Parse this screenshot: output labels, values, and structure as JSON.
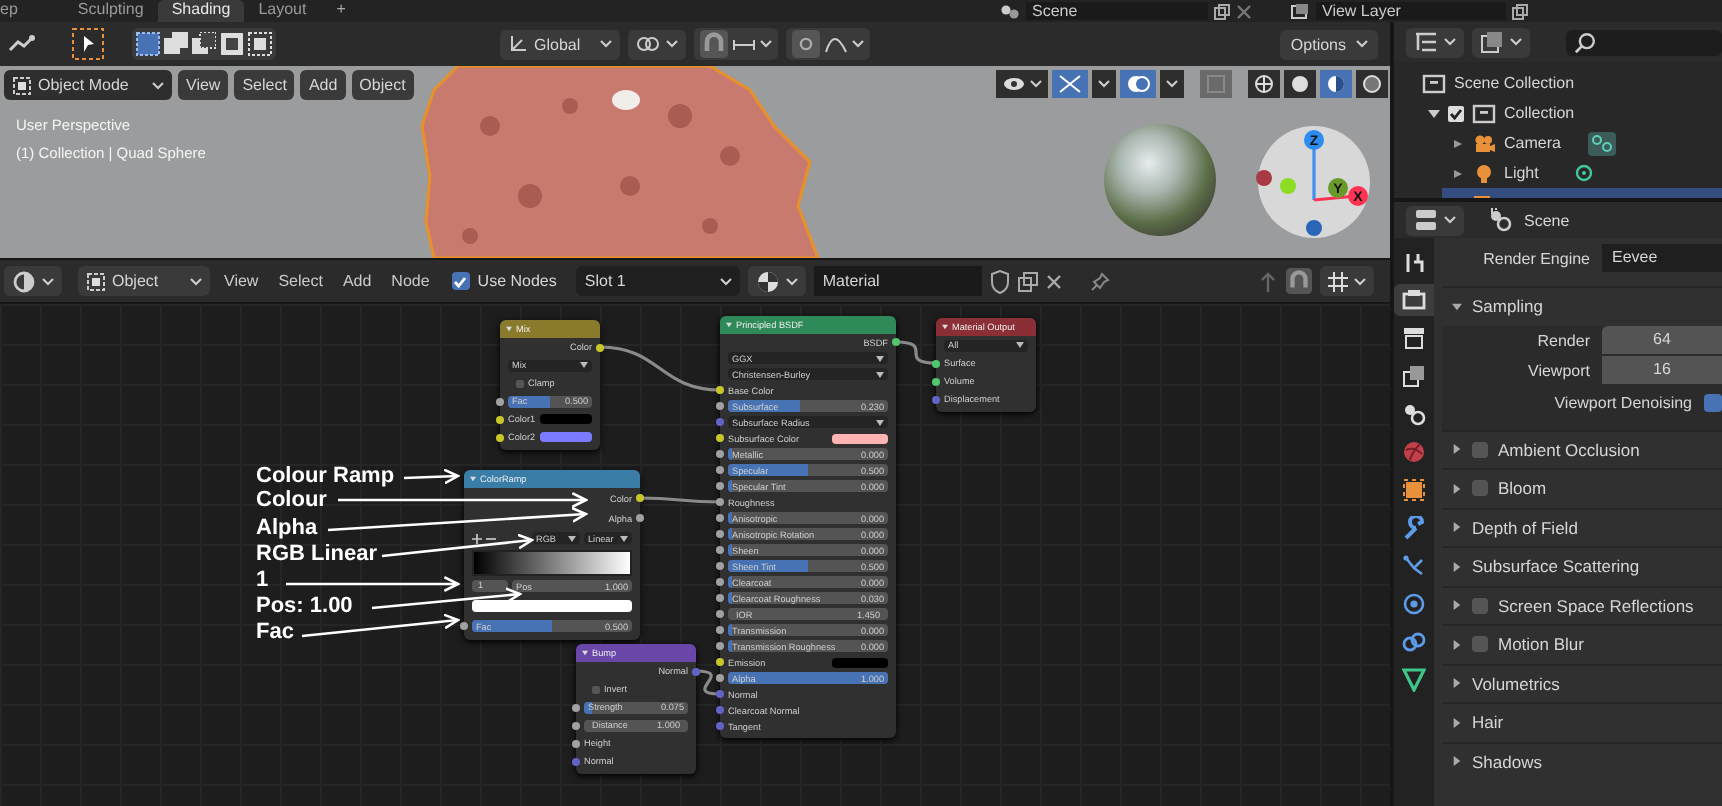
{
  "top_bar": {
    "workspace_tabs": [
      {
        "label": "ep",
        "selected": false
      },
      {
        "label": "Sculpting",
        "selected": false
      },
      {
        "label": "Shading",
        "selected": true
      },
      {
        "label": "Layout",
        "selected": false
      }
    ],
    "add_tab": "+",
    "scene": "Scene",
    "view_layer": "View Layer"
  },
  "viewport": {
    "orientation": "Global",
    "options": "Options",
    "mode": "Object Mode",
    "menus": [
      "View",
      "Select",
      "Add",
      "Object"
    ],
    "overlay_lines": [
      "User Perspective",
      "(1) Collection | Quad Sphere"
    ],
    "gizmo_axes": [
      "Z",
      "Y",
      "X"
    ]
  },
  "node_editor": {
    "header": {
      "type": "Object",
      "menus": [
        "View",
        "Select",
        "Add",
        "Node"
      ],
      "use_nodes": {
        "label": "Use Nodes",
        "checked": true
      },
      "slot": "Slot 1",
      "material": "Material"
    },
    "nodes": [
      {
        "title": "Mix",
        "kind": "color",
        "rows": [
          {
            "kind": "output",
            "label": "Color",
            "socket": {
              "color": "#c7c729"
            }
          },
          {
            "kind": "select",
            "label": "Mix"
          },
          {
            "kind": "check",
            "label": "Clamp",
            "checked": false
          },
          {
            "kind": "value",
            "label": "Fac",
            "value": "0.500",
            "level": 0.5,
            "socket": {
              "color": "#a1a1a1"
            }
          },
          {
            "kind": "color",
            "label": "Color1",
            "color": "#000000",
            "socket": {
              "color": "#c7c729"
            }
          },
          {
            "kind": "color",
            "label": "Color2",
            "color": "#7b7bff",
            "socket": {
              "color": "#c7c729"
            }
          }
        ]
      },
      {
        "title": "Principled BSDF",
        "kind": "shader",
        "rows": [
          {
            "kind": "output",
            "label": "BSDF",
            "socket": {
              "color": "#4fc76f"
            }
          },
          {
            "kind": "select",
            "label": "GGX"
          },
          {
            "kind": "select",
            "label": "Christensen-Burley"
          },
          {
            "kind": "input",
            "label": "Base Color",
            "socket": {
              "color": "#c7c729"
            }
          },
          {
            "kind": "value",
            "label": "Subsurface",
            "value": "0.230",
            "level": 0.45,
            "socket": {
              "color": "#a1a1a1"
            }
          },
          {
            "kind": "select",
            "label": "Subsurface Radius",
            "socket": {
              "color": "#6363c7"
            }
          },
          {
            "kind": "color",
            "label": "Subsurface Color",
            "color": "#ffb3b3",
            "socket": {
              "color": "#c7c729"
            }
          },
          {
            "kind": "value",
            "label": "Metallic",
            "value": "0.000",
            "level": 0,
            "socket": {
              "color": "#a1a1a1"
            }
          },
          {
            "kind": "value",
            "label": "Specular",
            "value": "0.500",
            "level": 0.5,
            "socket": {
              "color": "#a1a1a1"
            }
          },
          {
            "kind": "value",
            "label": "Specular Tint",
            "value": "0.000",
            "level": 0,
            "socket": {
              "color": "#a1a1a1"
            }
          },
          {
            "kind": "input",
            "label": "Roughness",
            "socket": {
              "color": "#a1a1a1"
            }
          },
          {
            "kind": "value",
            "label": "Anisotropic",
            "value": "0.000",
            "level": 0,
            "socket": {
              "color": "#a1a1a1"
            }
          },
          {
            "kind": "value",
            "label": "Anisotropic Rotation",
            "value": "0.000",
            "level": 0,
            "socket": {
              "color": "#a1a1a1"
            }
          },
          {
            "kind": "value",
            "label": "Sheen",
            "value": "0.000",
            "level": 0,
            "socket": {
              "color": "#a1a1a1"
            }
          },
          {
            "kind": "value",
            "label": "Sheen Tint",
            "value": "0.500",
            "level": 0.5,
            "socket": {
              "color": "#a1a1a1"
            }
          },
          {
            "kind": "value",
            "label": "Clearcoat",
            "value": "0.000",
            "level": 0,
            "socket": {
              "color": "#a1a1a1"
            }
          },
          {
            "kind": "value",
            "label": "Clearcoat Roughness",
            "value": "0.030",
            "level": 0.03,
            "socket": {
              "color": "#a1a1a1"
            }
          },
          {
            "kind": "number",
            "label": "IOR",
            "value": "1.450",
            "socket": {
              "color": "#a1a1a1"
            }
          },
          {
            "kind": "value",
            "label": "Transmission",
            "value": "0.000",
            "level": 0,
            "socket": {
              "color": "#a1a1a1"
            }
          },
          {
            "kind": "value",
            "label": "Transmission Roughness",
            "value": "0.000",
            "level": 0,
            "socket": {
              "color": "#a1a1a1"
            }
          },
          {
            "kind": "color",
            "label": "Emission",
            "color": "#000000",
            "socket": {
              "color": "#c7c729"
            }
          },
          {
            "kind": "value",
            "label": "Alpha",
            "value": "1.000",
            "level": 1,
            "socket": {
              "color": "#a1a1a1"
            }
          },
          {
            "kind": "input",
            "label": "Normal",
            "socket": {
              "color": "#6363c7"
            }
          },
          {
            "kind": "input",
            "label": "Clearcoat Normal",
            "socket": {
              "color": "#6363c7"
            }
          },
          {
            "kind": "input",
            "label": "Tangent",
            "socket": {
              "color": "#6363c7"
            }
          }
        ]
      },
      {
        "title": "Material Output",
        "kind": "output",
        "rows": [
          {
            "kind": "select",
            "label": "All"
          },
          {
            "kind": "input",
            "label": "Surface",
            "socket": {
              "color": "#4fc76f"
            }
          },
          {
            "kind": "input",
            "label": "Volume",
            "socket": {
              "color": "#4fc76f"
            }
          },
          {
            "kind": "input",
            "label": "Displacement",
            "socket": {
              "color": "#6363c7"
            }
          }
        ]
      },
      {
        "title": "ColorRamp",
        "kind": "converter",
        "rows": [
          {
            "kind": "output",
            "label": "Color",
            "socket": {
              "color": "#c7c729"
            }
          },
          {
            "kind": "output",
            "label": "Alpha",
            "socket": {
              "color": "#a1a1a1"
            }
          },
          {
            "kind": "ramp_controls",
            "options": [
              "RGB",
              "Linear"
            ]
          },
          {
            "kind": "gradient"
          },
          {
            "kind": "stop",
            "index": "1",
            "label": "Pos",
            "value": "1.000"
          },
          {
            "kind": "swatch",
            "color": "#ffffff"
          },
          {
            "kind": "value",
            "label": "Fac",
            "value": "0.500",
            "level": 0.5,
            "socket": {
              "color": "#a1a1a1"
            }
          }
        ]
      },
      {
        "title": "Bump",
        "kind": "vector",
        "rows": [
          {
            "kind": "output",
            "label": "Normal",
            "socket": {
              "color": "#6363c7"
            }
          },
          {
            "kind": "check",
            "label": "Invert",
            "checked": false
          },
          {
            "kind": "value",
            "label": "Strength",
            "value": "0.075",
            "level": 0.075,
            "socket": {
              "color": "#a1a1a1"
            }
          },
          {
            "kind": "number",
            "label": "Distance",
            "value": "1.000",
            "socket": {
              "color": "#a1a1a1"
            }
          },
          {
            "kind": "input",
            "label": "Height",
            "socket": {
              "color": "#a1a1a1"
            }
          },
          {
            "kind": "input",
            "label": "Normal",
            "socket": {
              "color": "#6363c7"
            }
          }
        ]
      }
    ],
    "annotations": [
      "Colour Ramp",
      "Colour",
      "Alpha",
      "RGB Linear",
      "1",
      "Pos: 1.00",
      "Fac"
    ]
  },
  "outliner": {
    "items": [
      {
        "label": "Scene Collection",
        "kind": "scene",
        "selected": false,
        "children": [
          {
            "label": "Collection",
            "kind": "collection",
            "checked": true,
            "expanded": true,
            "selected": false,
            "children": [
              {
                "label": "Camera",
                "kind": "camera",
                "selected": false
              },
              {
                "label": "Light",
                "kind": "light",
                "selected": false
              },
              {
                "kind": "mesh",
                "selected": true
              }
            ]
          }
        ]
      }
    ]
  },
  "properties": {
    "context": "Scene",
    "tabs": [
      {
        "kind": "tool",
        "selected": false
      },
      {
        "kind": "render",
        "selected": true
      },
      {
        "kind": "output",
        "selected": false
      },
      {
        "kind": "view_layer",
        "selected": false
      },
      {
        "kind": "scene",
        "selected": false
      },
      {
        "kind": "world",
        "selected": false
      },
      {
        "kind": "object",
        "selected": false
      },
      {
        "kind": "modifier",
        "selected": false
      },
      {
        "kind": "particles",
        "selected": false
      },
      {
        "kind": "physics",
        "selected": false
      },
      {
        "kind": "constraint",
        "selected": false
      },
      {
        "kind": "data",
        "selected": false
      }
    ],
    "render_engine": {
      "label": "Render Engine",
      "value": "Eevee"
    },
    "sampling": {
      "title": "Sampling",
      "expanded": true,
      "fields": [
        {
          "label": "Render",
          "value": "64"
        },
        {
          "label": "Viewport",
          "value": "16"
        }
      ],
      "denoising": {
        "label": "Viewport Denoising",
        "checked": true
      }
    },
    "panels": [
      {
        "label": "Ambient Occlusion",
        "kind": "toggle",
        "checked": false
      },
      {
        "label": "Bloom",
        "kind": "toggle",
        "checked": false
      },
      {
        "label": "Depth of Field",
        "kind": "plain"
      },
      {
        "label": "Subsurface Scattering",
        "kind": "plain"
      },
      {
        "label": "Screen Space Reflections",
        "kind": "toggle",
        "checked": false
      },
      {
        "label": "Motion Blur",
        "kind": "toggle",
        "checked": false
      },
      {
        "label": "Volumetrics",
        "kind": "plain"
      },
      {
        "label": "Hair",
        "kind": "plain"
      },
      {
        "label": "Shadows",
        "kind": "plain"
      }
    ]
  }
}
